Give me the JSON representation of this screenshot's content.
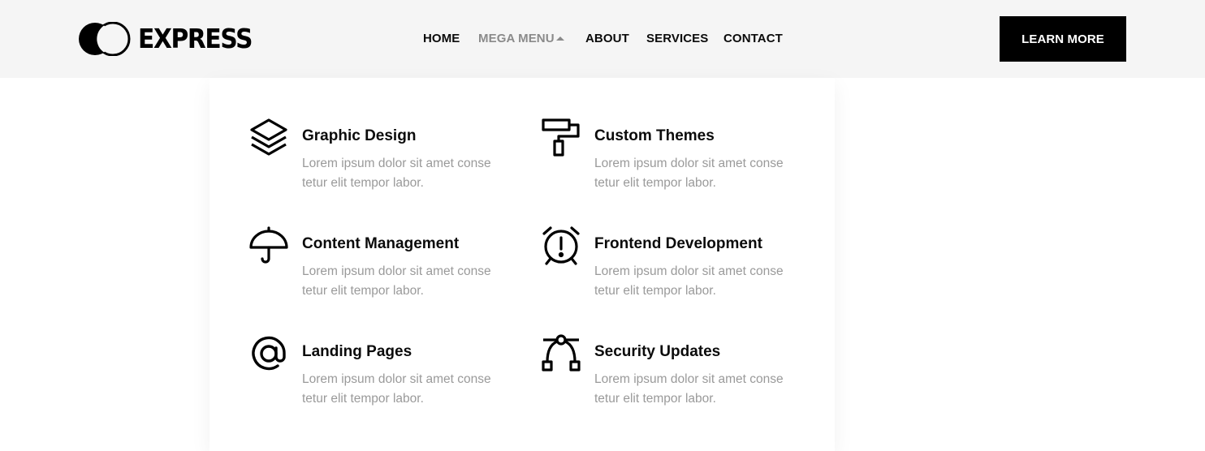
{
  "brand": {
    "name": "EXPRESS",
    "icon": "double-circle-logo-icon"
  },
  "nav": {
    "items": [
      {
        "label": "HOME"
      },
      {
        "label": "MEGA MENU",
        "active": true,
        "icon": "caret-up-icon"
      },
      {
        "label": "ABOUT"
      },
      {
        "label": "SERVICES"
      },
      {
        "label": "CONTACT"
      }
    ]
  },
  "cta": {
    "label": "LEARN MORE"
  },
  "mega_menu": {
    "items": [
      {
        "title": "Graphic Design",
        "desc": "Lorem ipsum dolor sit amet conse tetur elit tempor labor.",
        "icon": "layers-icon"
      },
      {
        "title": "Custom Themes",
        "desc": "Lorem ipsum dolor sit amet conse tetur elit tempor labor.",
        "icon": "paint-roller-icon"
      },
      {
        "title": "Content Management",
        "desc": "Lorem ipsum dolor sit amet conse tetur elit tempor labor.",
        "icon": "umbrella-icon"
      },
      {
        "title": "Frontend Development",
        "desc": "Lorem ipsum dolor sit amet conse tetur elit tempor labor.",
        "icon": "alarm-clock-icon"
      },
      {
        "title": "Landing Pages",
        "desc": "Lorem ipsum dolor sit amet conse tetur elit tempor labor.",
        "icon": "at-sign-icon"
      },
      {
        "title": "Security Updates",
        "desc": "Lorem ipsum dolor sit amet conse tetur elit tempor labor.",
        "icon": "bezier-pen-icon"
      }
    ]
  },
  "colors": {
    "header_bg": "#f5f5f5",
    "text": "#0b0b0b",
    "muted": "#9a9a9a",
    "active_nav": "#8a8a8a",
    "cta_bg": "#000000"
  }
}
